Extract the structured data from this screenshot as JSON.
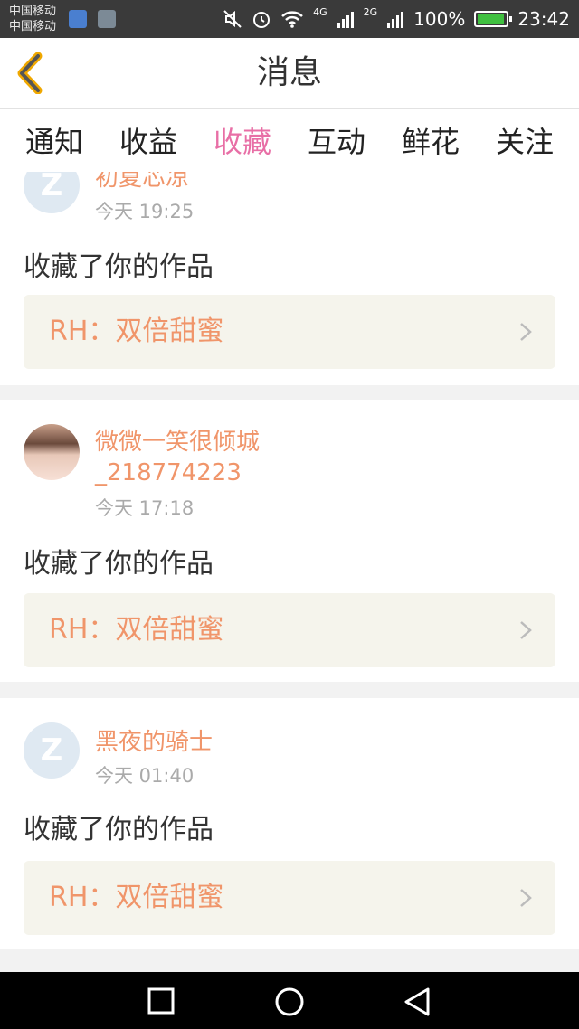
{
  "status": {
    "carrier1": "中国移动",
    "carrier2": "中国移动",
    "net1": "4G",
    "net2": "2G",
    "battery": "100%",
    "time": "23:42"
  },
  "header": {
    "title": "消息"
  },
  "tabs": [
    {
      "label": "通知"
    },
    {
      "label": "收益"
    },
    {
      "label": "收藏",
      "active": true
    },
    {
      "label": "互动"
    },
    {
      "label": "鲜花"
    },
    {
      "label": "关注"
    }
  ],
  "items": [
    {
      "user": "初夏芯凉",
      "time": "今天 19:25",
      "action": "收藏了你的作品",
      "work": "RH：双倍甜蜜"
    },
    {
      "user": "微微一笑很倾城_218774223",
      "time": "今天 17:18",
      "action": "收藏了你的作品",
      "work": "RH：双倍甜蜜"
    },
    {
      "user": "黑夜的骑士",
      "time": "今天 01:40",
      "action": "收藏了你的作品",
      "work": "RH：双倍甜蜜"
    }
  ],
  "colors": {
    "accent": "#e86fa6",
    "username": "#f0956a",
    "work_bg": "#f5f4ec"
  }
}
